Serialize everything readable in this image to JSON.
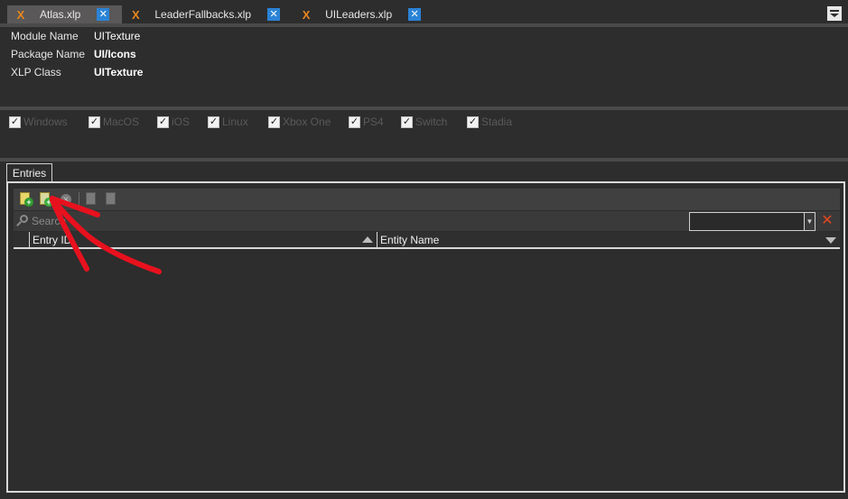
{
  "tabs": [
    {
      "label": "Atlas.xlp",
      "active": true
    },
    {
      "label": "LeaderFallbacks.xlp",
      "active": false
    },
    {
      "label": "UILeaders.xlp",
      "active": false
    }
  ],
  "tab_glyph": "X",
  "close_glyph": "✕",
  "properties": [
    {
      "label": "Module Name",
      "value": "UITexture"
    },
    {
      "label": "Package Name",
      "value": "UI/Icons"
    },
    {
      "label": "XLP Class",
      "value": "UITexture"
    }
  ],
  "platforms": [
    "Windows",
    "MacOS",
    "iOS",
    "Linux",
    "Xbox One",
    "PS4",
    "Switch",
    "Stadia"
  ],
  "check_glyph": "✓",
  "entries_tab": "Entries",
  "search": {
    "placeholder": "Search",
    "value": ""
  },
  "clear_glyph": "✕",
  "combo_arrow": "▼",
  "columns": [
    "Entry ID",
    "Entity Name"
  ],
  "colors": {
    "background": "#2d2d2d",
    "active_tab": "#5a5858",
    "tab_x": "#e8871e",
    "close_button": "#2a83d6",
    "clear_x": "#e5471e",
    "annotation_arrow": "#e8111e"
  },
  "icons": [
    "hamburger-menu-icon",
    "add-entry-icon",
    "add-entry-green-icon",
    "remove-entry-icon",
    "refresh-icon",
    "export-icon",
    "search-icon",
    "clear-filter-icon",
    "red-annotation-arrow"
  ]
}
